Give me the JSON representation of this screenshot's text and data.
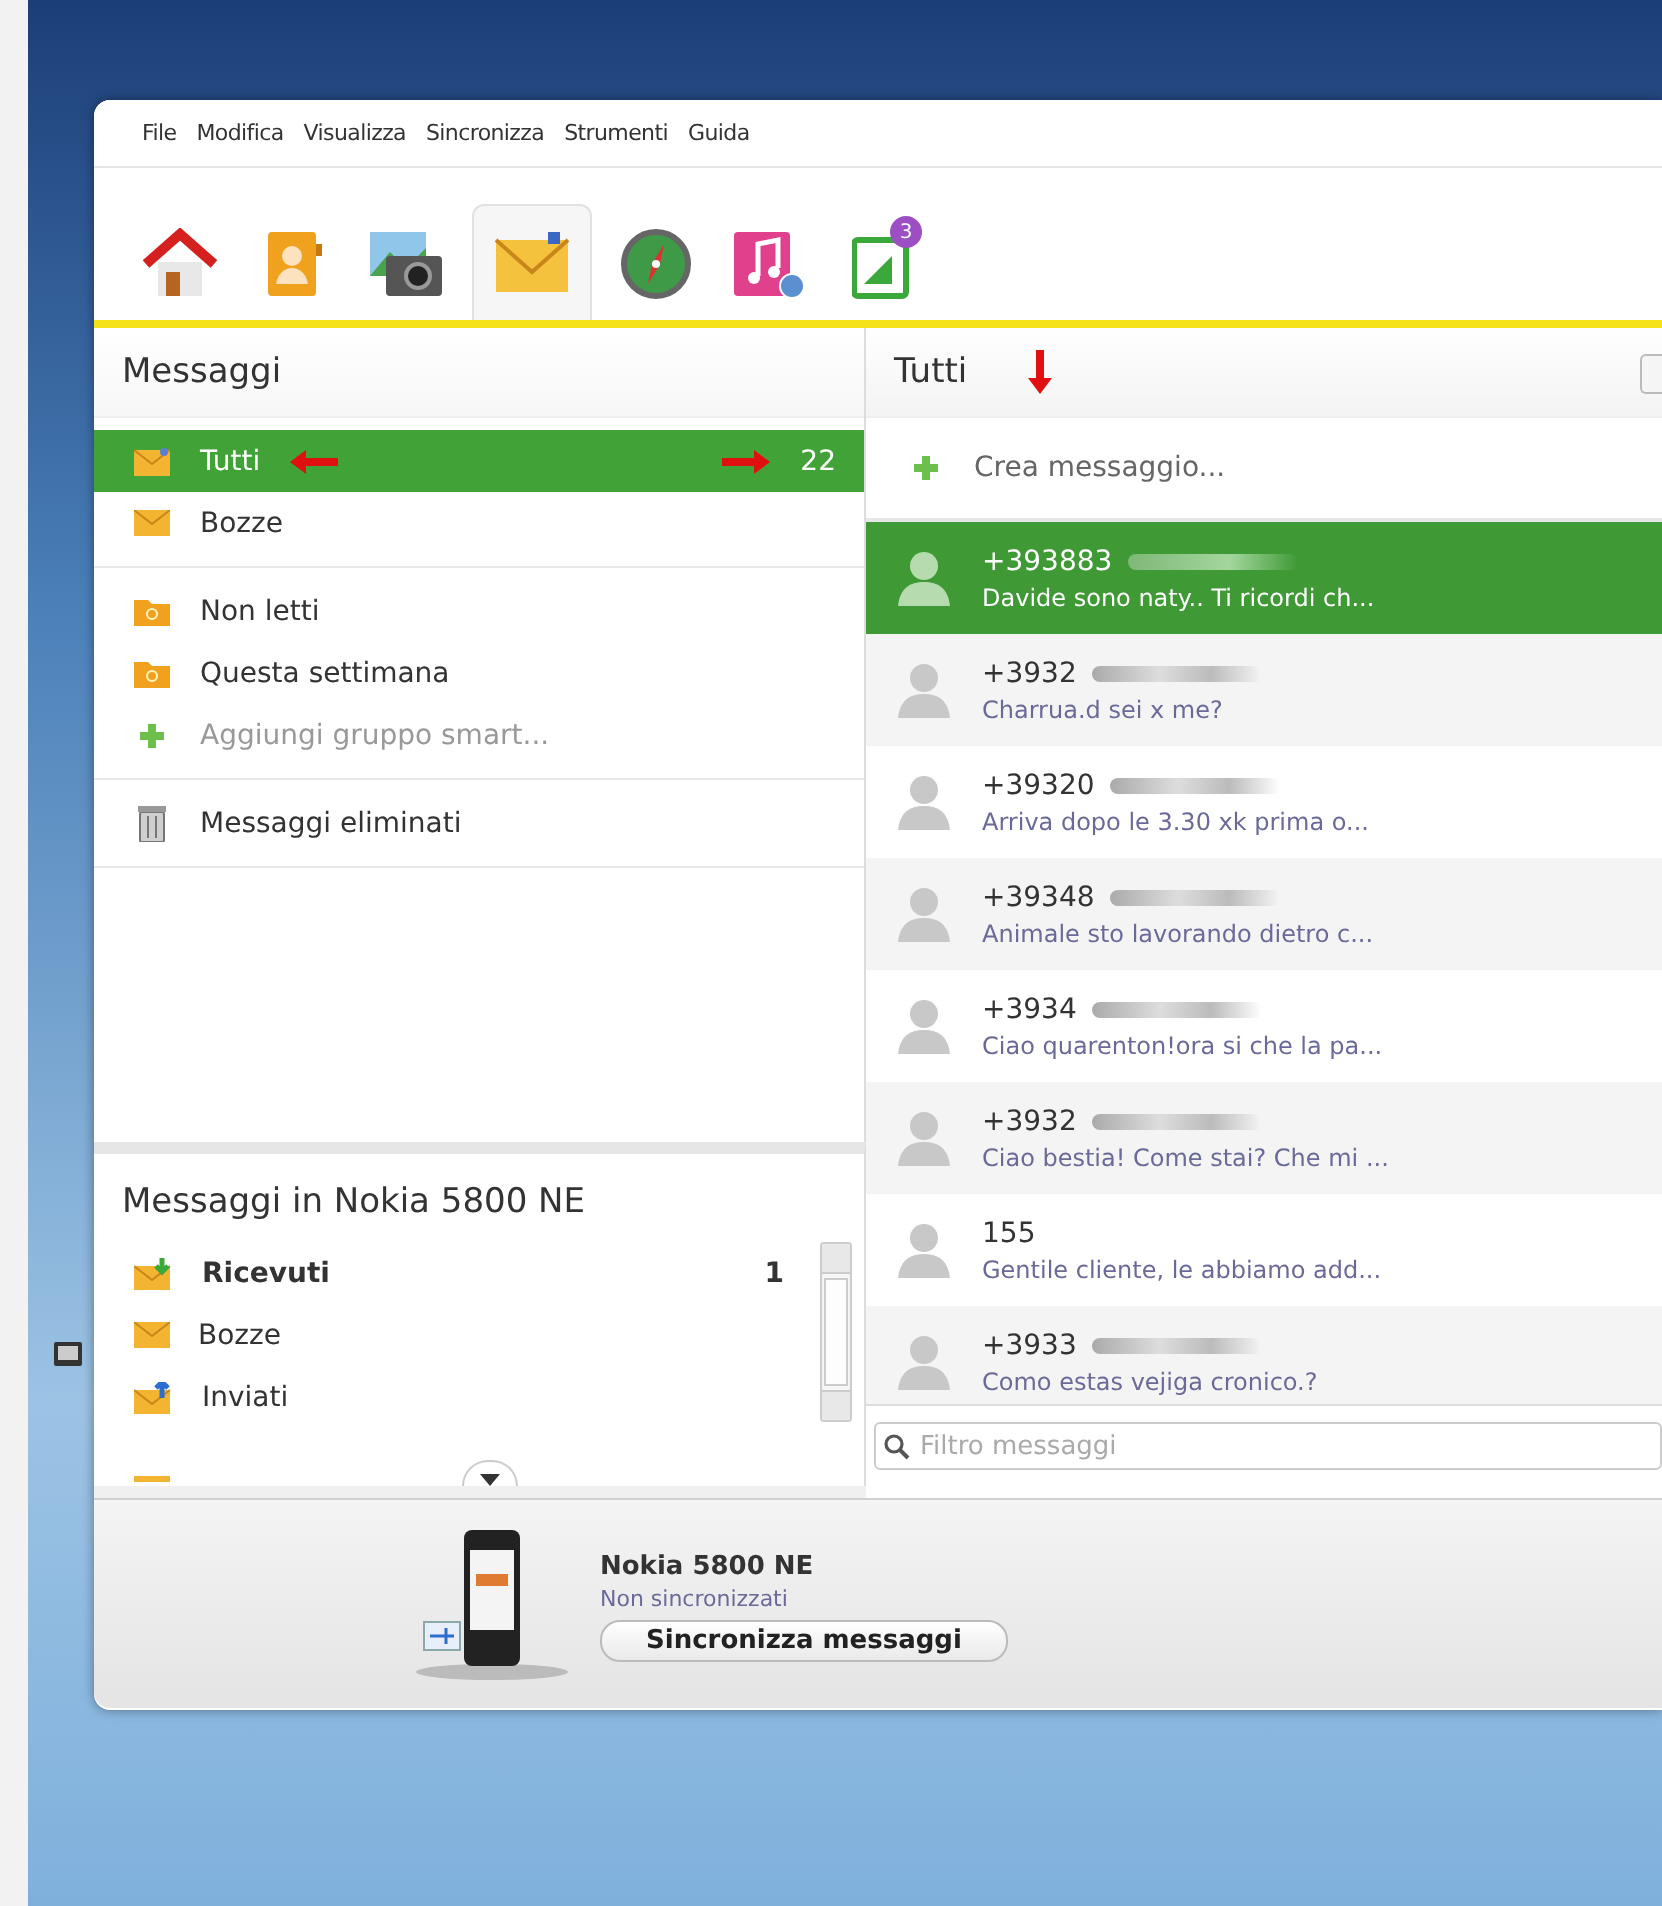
{
  "menu": [
    "File",
    "Modifica",
    "Visualizza",
    "Sincronizza",
    "Strumenti",
    "Guida"
  ],
  "toolbar": [
    {
      "kind": "home",
      "selected": false
    },
    {
      "kind": "contacts",
      "selected": false
    },
    {
      "kind": "photos",
      "selected": false
    },
    {
      "kind": "messages",
      "selected": true
    },
    {
      "kind": "maps",
      "selected": false
    },
    {
      "kind": "music",
      "selected": false
    },
    {
      "kind": "apps",
      "selected": false,
      "badge": "3"
    }
  ],
  "folders": {
    "title": "Messaggi",
    "groups": [
      [
        {
          "kind": "all",
          "label": "Tutti",
          "count": "22",
          "selected": true
        },
        {
          "kind": "drafts",
          "label": "Bozze",
          "selected": false
        }
      ],
      [
        {
          "kind": "smart",
          "label": "Non letti",
          "selected": false
        },
        {
          "kind": "smart",
          "label": "Questa settimana",
          "selected": false
        },
        {
          "kind": "add",
          "label": "Aggiungi gruppo smart...",
          "selected": false
        }
      ],
      [
        {
          "kind": "trash",
          "label": "Messaggi eliminati",
          "selected": false
        }
      ]
    ]
  },
  "device_folders": {
    "title": "Messaggi in Nokia 5800 NE",
    "items": [
      {
        "kind": "inbox",
        "label": "Ricevuti",
        "count": "1",
        "unread": true
      },
      {
        "kind": "drafts",
        "label": "Bozze",
        "unread": false
      },
      {
        "kind": "sent",
        "label": "Inviati",
        "unread": false
      }
    ]
  },
  "device": {
    "name": "Nokia 5800 NE",
    "status": "Non sincronizzati",
    "sync_button": "Sincronizza messaggi"
  },
  "conversation": {
    "title": "Tutti",
    "create": "Crea messaggio...",
    "messages": [
      {
        "sender": "+393883",
        "blurred": true,
        "preview": "Davide sono naty.. Ti ricordi ch...",
        "selected": true
      },
      {
        "sender": "+3932",
        "blurred": true,
        "preview": "Charrua.d sei x me?",
        "selected": false
      },
      {
        "sender": "+39320",
        "blurred": true,
        "preview": "Arriva dopo le 3.30 xk prima o...",
        "selected": false
      },
      {
        "sender": "+39348",
        "blurred": true,
        "preview": "Animale sto lavorando dietro c...",
        "selected": false
      },
      {
        "sender": "+3934",
        "blurred": true,
        "preview": "Ciao quarenton!ora si che la pa...",
        "selected": false
      },
      {
        "sender": "+3932",
        "blurred": true,
        "preview": "Ciao bestia! Come stai? Che mi ...",
        "selected": false
      },
      {
        "sender": "155",
        "blurred": false,
        "preview": "Gentile cliente, le abbiamo add...",
        "selected": false
      },
      {
        "sender": "+3933",
        "blurred": true,
        "preview": "Como  estas vejiga cronico.?",
        "selected": false
      }
    ],
    "filter": {
      "placeholder": "Filtro messaggi"
    }
  }
}
